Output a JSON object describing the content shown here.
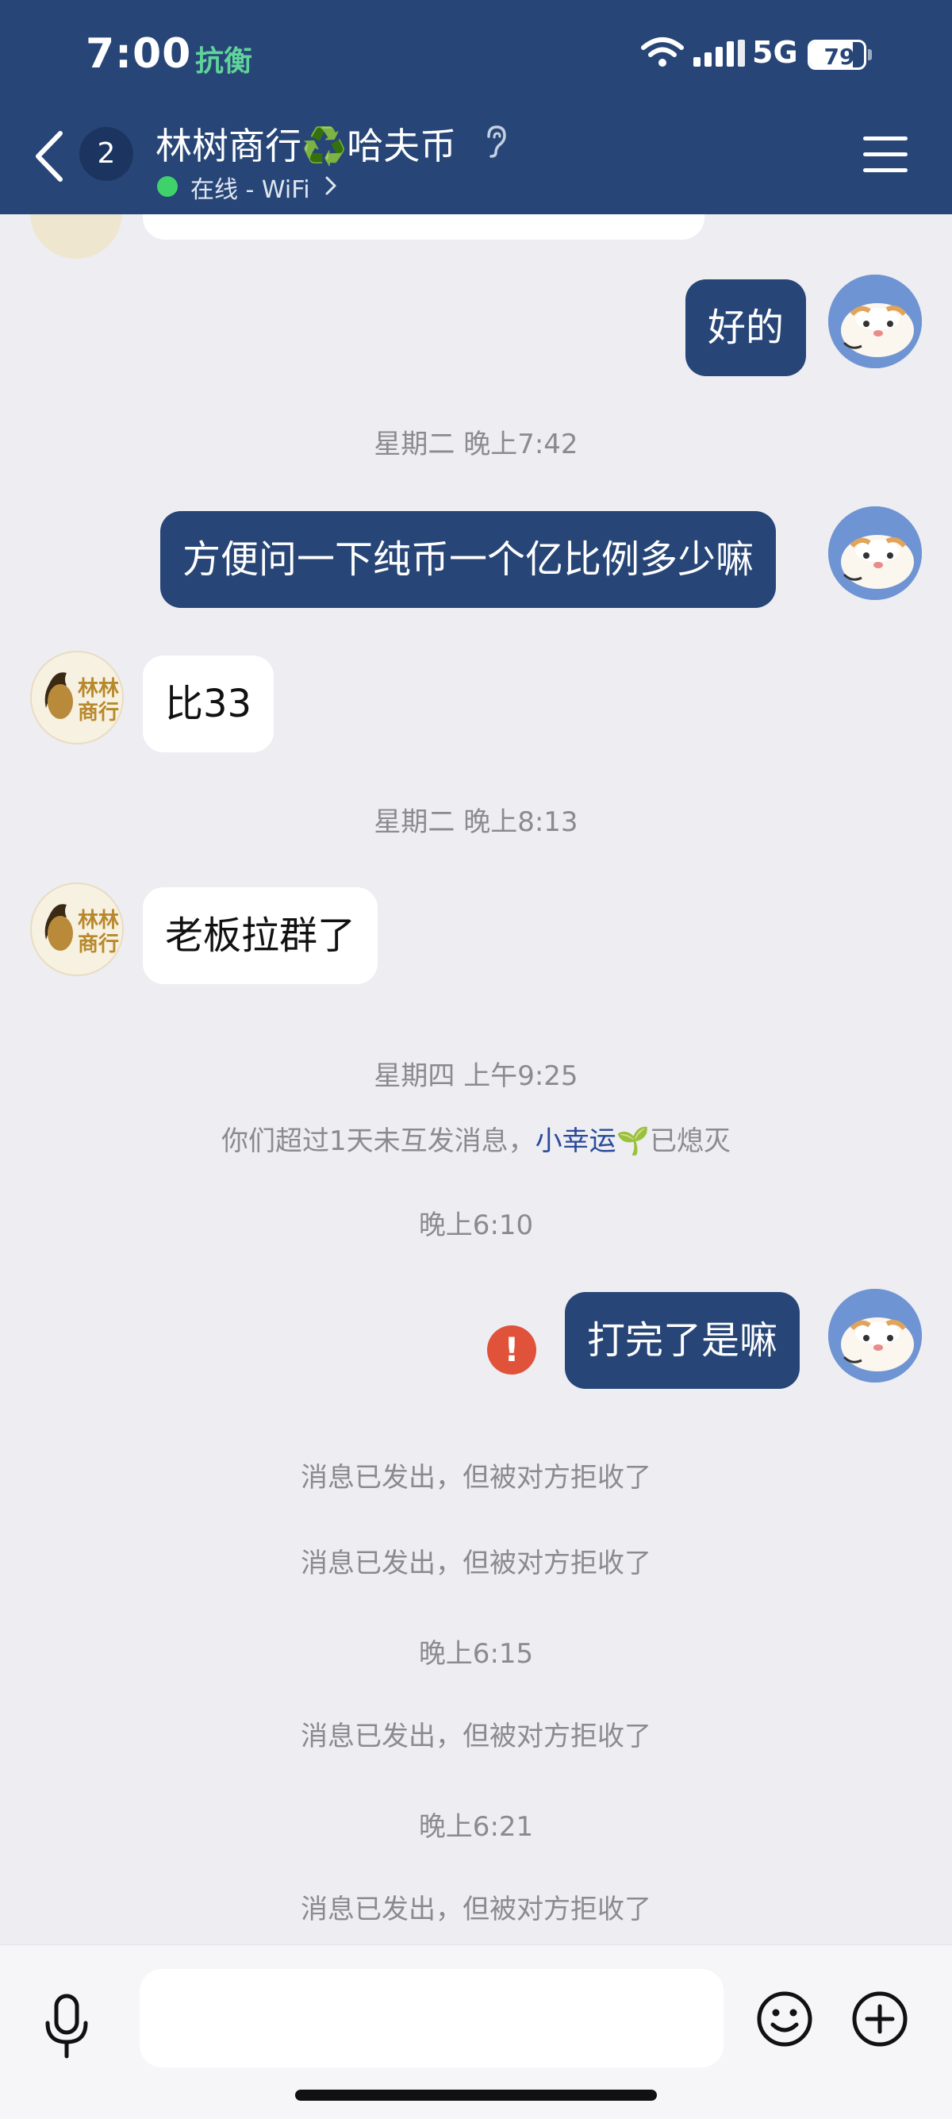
{
  "status_bar": {
    "time": "7:00",
    "tag": "抗衡",
    "network": "5G",
    "battery": 79,
    "battery_text": "79"
  },
  "header": {
    "unread_count": "2",
    "title": "林树商行",
    "title_emoji": "♻️",
    "title_suffix": "哈夫币",
    "status_text": "在线 - WiFi",
    "online_color": "#3fd26a"
  },
  "avatar_them_text": {
    "line1": "林林",
    "line2": "商行"
  },
  "messages": {
    "m1": "好的",
    "ts1": "星期二 晚上7:42",
    "m2": "方便问一下纯币一个亿比例多少嘛",
    "m3": "比33",
    "ts2": "星期二 晚上8:13",
    "m4": "老板拉群了",
    "ts3": "星期四 上午9:25",
    "note_prefix": "你们超过1天未互发消息，",
    "note_name": "小幸运",
    "note_emoji": "🌱",
    "note_suffix": "已熄灭",
    "ts4": "晚上6:10",
    "m5": "打完了是嘛",
    "error_mark": "!",
    "rejected1": "消息已发出，但被对方拒收了",
    "rejected2": "消息已发出，但被对方拒收了",
    "ts5": "晚上6:15",
    "rejected3": "消息已发出，但被对方拒收了",
    "ts6": "晚上6:21",
    "rejected4": "消息已发出，但被对方拒收了"
  },
  "input": {
    "value": "",
    "placeholder": ""
  },
  "colors": {
    "header_bg": "#274677",
    "outgoing_bubble": "#274677",
    "incoming_bubble": "#ffffff",
    "error": "#e0523a",
    "background": "#ededf2"
  }
}
